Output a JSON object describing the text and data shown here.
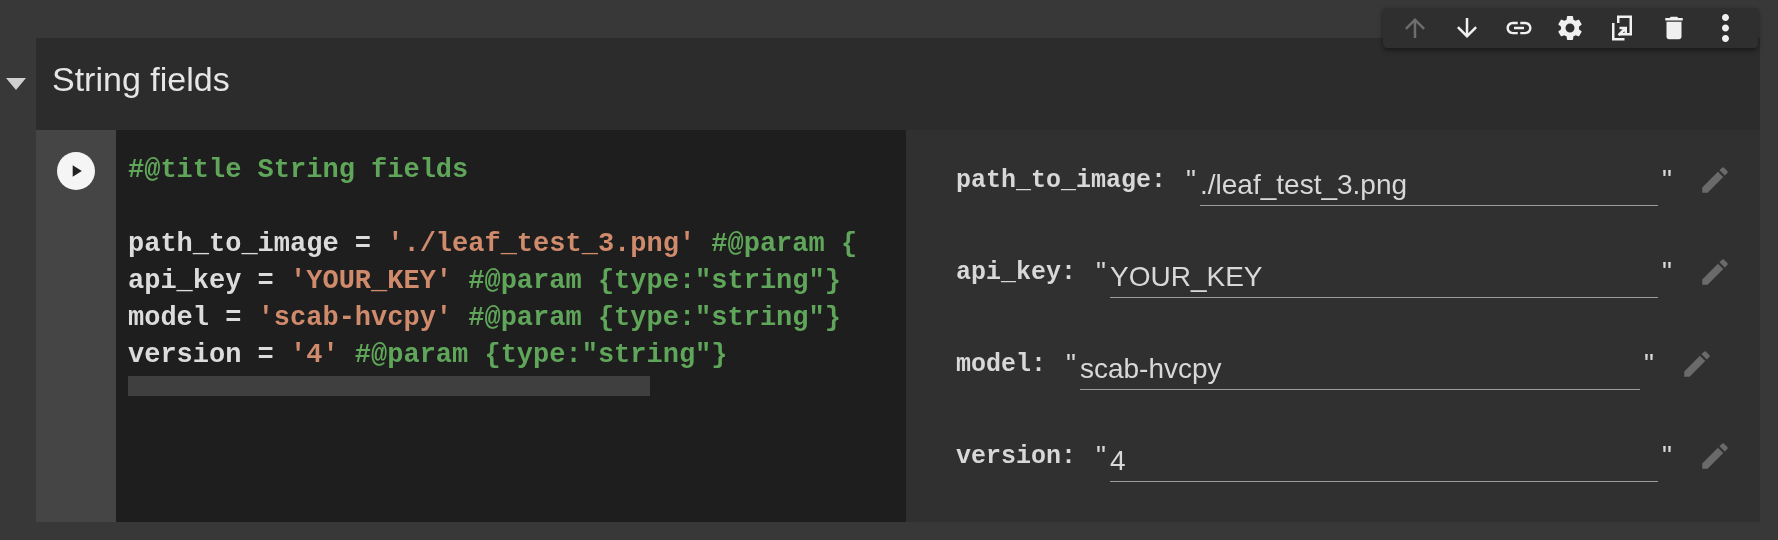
{
  "toolbar": [
    {
      "kind": "up",
      "disabled": true
    },
    {
      "kind": "down",
      "disabled": false
    },
    {
      "kind": "link",
      "disabled": false
    },
    {
      "kind": "settings",
      "disabled": false
    },
    {
      "kind": "mirror",
      "disabled": false
    },
    {
      "kind": "delete",
      "disabled": false
    },
    {
      "kind": "more",
      "disabled": false
    }
  ],
  "cell": {
    "expanded": true,
    "title": "String fields",
    "code_lines": [
      {
        "gap_before": false,
        "tokens": [
          {
            "kind": "comment",
            "text": "#@title String fields"
          }
        ]
      },
      {
        "gap_before": true,
        "tokens": [
          {
            "kind": "plain",
            "text": "path_to_image = "
          },
          {
            "kind": "string",
            "text": "'./leaf_test_3.png'"
          },
          {
            "kind": "comment",
            "text": " #@param {"
          }
        ]
      },
      {
        "gap_before": false,
        "tokens": [
          {
            "kind": "plain",
            "text": "api_key = "
          },
          {
            "kind": "string",
            "text": "'YOUR_KEY'"
          },
          {
            "kind": "comment",
            "text": " #@param {type:\"string\"}"
          }
        ]
      },
      {
        "gap_before": false,
        "tokens": [
          {
            "kind": "plain",
            "text": "model = "
          },
          {
            "kind": "string",
            "text": "'scab-hvcpy'"
          },
          {
            "kind": "comment",
            "text": " #@param {type:\"string\"}"
          }
        ]
      },
      {
        "gap_before": false,
        "tokens": [
          {
            "kind": "plain",
            "text": "version = "
          },
          {
            "kind": "string",
            "text": "'4'"
          },
          {
            "kind": "comment",
            "text": " #@param {type:\"string\"}"
          }
        ]
      }
    ],
    "form": {
      "fields": [
        {
          "label": "path_to_image:",
          "open_quote": "\"",
          "value": "./leaf_test_3.png",
          "close_quote": "\""
        },
        {
          "label": "api_key:",
          "open_quote": "\"",
          "value": "YOUR_KEY",
          "close_quote": "\""
        },
        {
          "label": "model:",
          "open_quote": "\"",
          "value": "scab-hvcpy",
          "close_quote": "\""
        },
        {
          "label": "version:",
          "open_quote": "\"",
          "value": "4",
          "close_quote": "\""
        }
      ]
    }
  }
}
